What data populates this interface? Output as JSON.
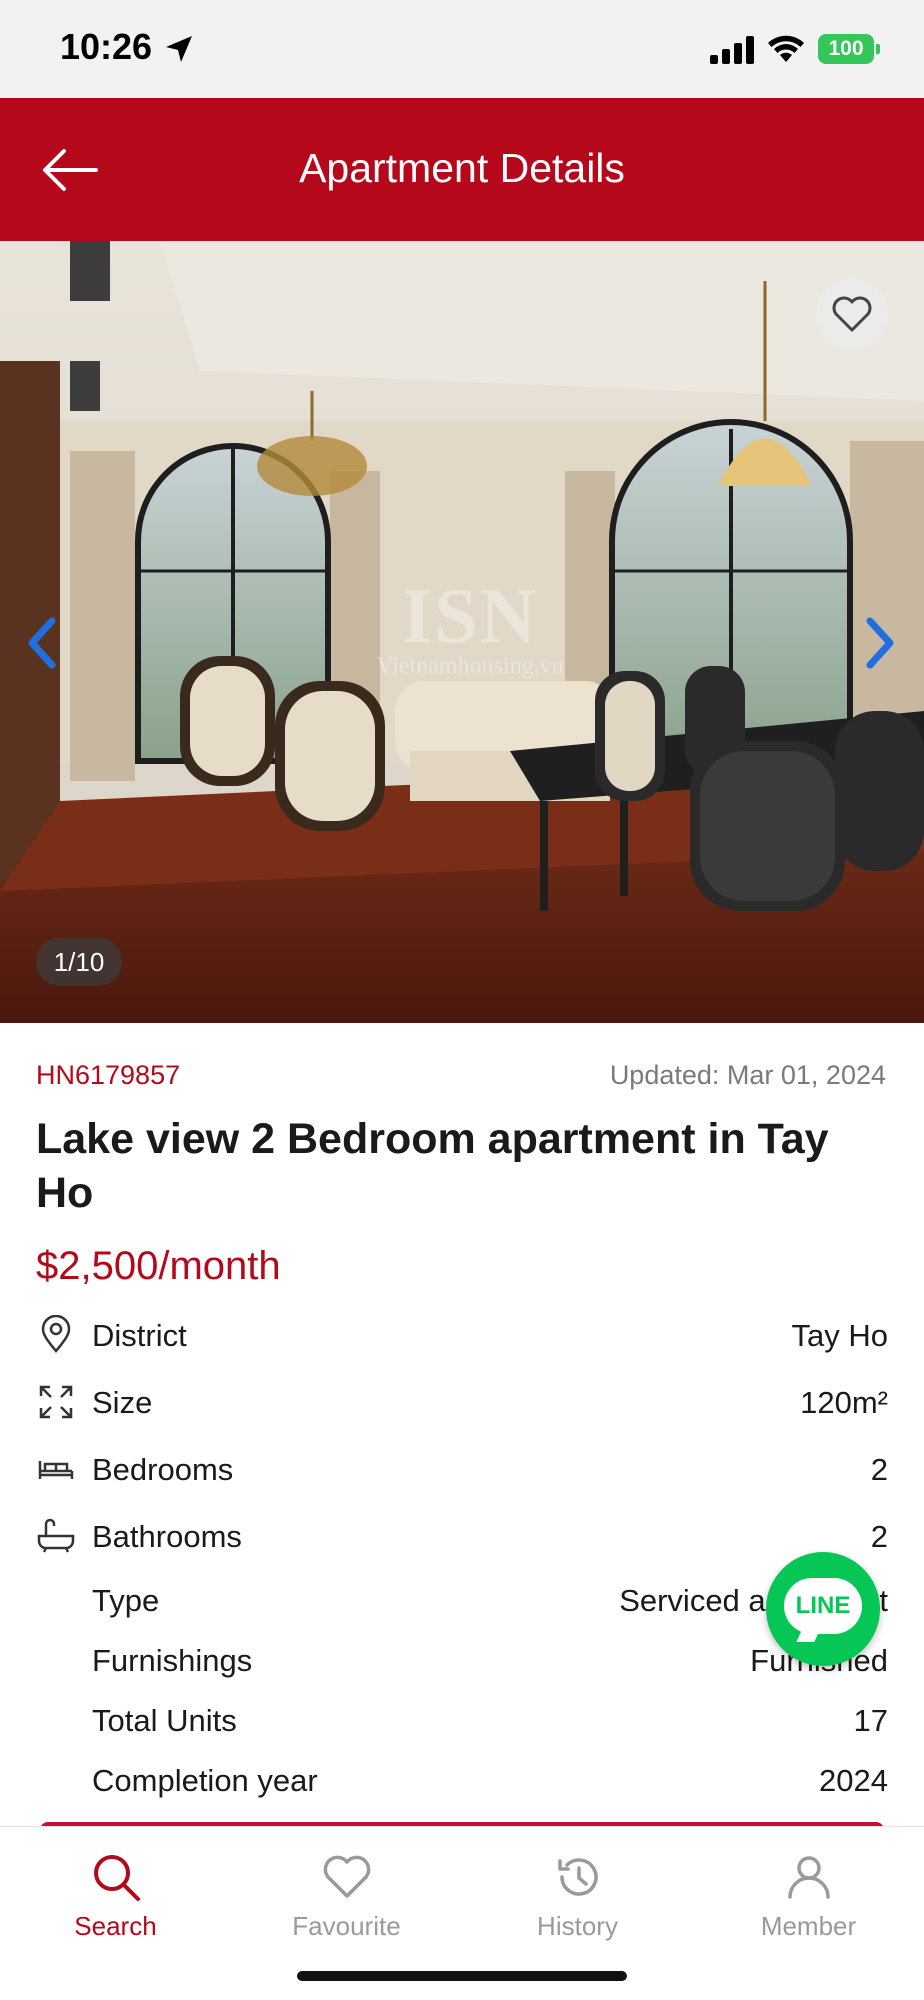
{
  "status_bar": {
    "time": "10:26",
    "battery": "100"
  },
  "header": {
    "title": "Apartment Details"
  },
  "gallery": {
    "counter": "1/10",
    "watermark_logo": "ISN",
    "watermark_site": "Vietnamhousing.vn"
  },
  "listing": {
    "id": "HN6179857",
    "updated": "Updated: Mar 01, 2024",
    "title": "Lake view 2 Bedroom apartment in Tay Ho",
    "price": "$2,500/month"
  },
  "specs": [
    {
      "label": "District",
      "value": "Tay Ho",
      "icon": "location-pin-icon"
    },
    {
      "label": "Size",
      "value": "120m²",
      "icon": "expand-arrows-icon"
    },
    {
      "label": "Bedrooms",
      "value": "2",
      "icon": "bed-icon"
    },
    {
      "label": "Bathrooms",
      "value": "2",
      "icon": "bathtub-icon"
    },
    {
      "label": "Type",
      "value": "Serviced apartment"
    },
    {
      "label": "Furnishings",
      "value": "Furnished"
    },
    {
      "label": "Total Units",
      "value": "17"
    },
    {
      "label": "Completion year",
      "value": "2024"
    }
  ],
  "line_chat": {
    "label": "LINE"
  },
  "bottom_nav": [
    {
      "label": "Search",
      "icon": "search-icon",
      "active": true
    },
    {
      "label": "Favourite",
      "icon": "heart-icon",
      "active": false
    },
    {
      "label": "History",
      "icon": "history-icon",
      "active": false
    },
    {
      "label": "Member",
      "icon": "user-icon",
      "active": false
    }
  ],
  "colors": {
    "brand": "#b5081b",
    "line_green": "#06c755",
    "battery_green": "#33c759",
    "muted": "#9a9a9a"
  }
}
